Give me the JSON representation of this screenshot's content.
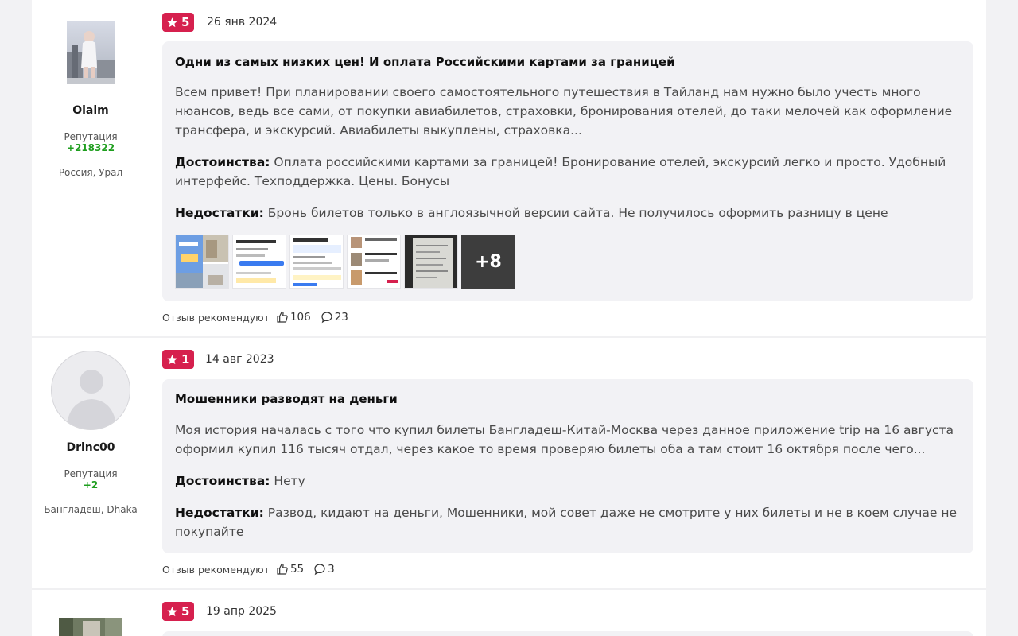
{
  "reviews": [
    {
      "user": {
        "name": "Olaim",
        "reputation_label": "Репутация",
        "reputation_value": "+218322",
        "location": "Россия, Урал"
      },
      "rating": "5",
      "date": "26 янв 2024",
      "title": "Одни из самых низких цен! И оплата Российскими картами за границей",
      "body": "Всем привет! При планировании своего самостоятельного путешествия в Тайланд нам нужно было учесть много нюансов, ведь все сами, от покупки авиабилетов, страховки, бронирования отелей, до таки мелочей как оформление трансфера, и экскурсий. Авиабилеты выкуплены, страховка...",
      "pros_label": "Достоинства:",
      "pros": "Оплата российскими картами за границей! Бронирование отелей, экскурсий легко и просто. Удобный интерфейс. Техподдержка. Цены. Бонусы",
      "cons_label": "Недостатки:",
      "cons": "Бронь билетов только в англоязычной версии сайта. Не получилось оформить разницу в цене",
      "more_photos": "+8",
      "recommend_label": "Отзыв рекомендуют",
      "likes": "106",
      "comments": "23"
    },
    {
      "user": {
        "name": "Drinc00",
        "reputation_label": "Репутация",
        "reputation_value": "+2",
        "location": "Бангладеш, Dhaka"
      },
      "rating": "1",
      "date": "14 авг 2023",
      "title": "Мошенники разводят на деньги",
      "body": "Моя история началась с того что купил билеты Бангладеш-Китай-Москва через данное приложение trip на 16 августа оформил купил 116 тысяч отдал, через какое то время проверяю билеты оба а там стоит 16 октября после чего...",
      "pros_label": "Достоинства:",
      "pros": "Нету",
      "cons_label": "Недостатки:",
      "cons": "Развод, кидают на деньги, Мошенники, мой совет даже не смотрите у них билеты и не в коем случае не покупайте",
      "recommend_label": "Отзыв рекомендуют",
      "likes": "55",
      "comments": "3"
    },
    {
      "rating": "5",
      "date": "19 апр 2025"
    }
  ],
  "colors": {
    "badge": "#d6204e",
    "reputation": "#1e9e1e",
    "bubble": "#f2f2f5"
  },
  "icons": [
    "star-icon",
    "thumbs-up-icon",
    "comment-icon"
  ]
}
